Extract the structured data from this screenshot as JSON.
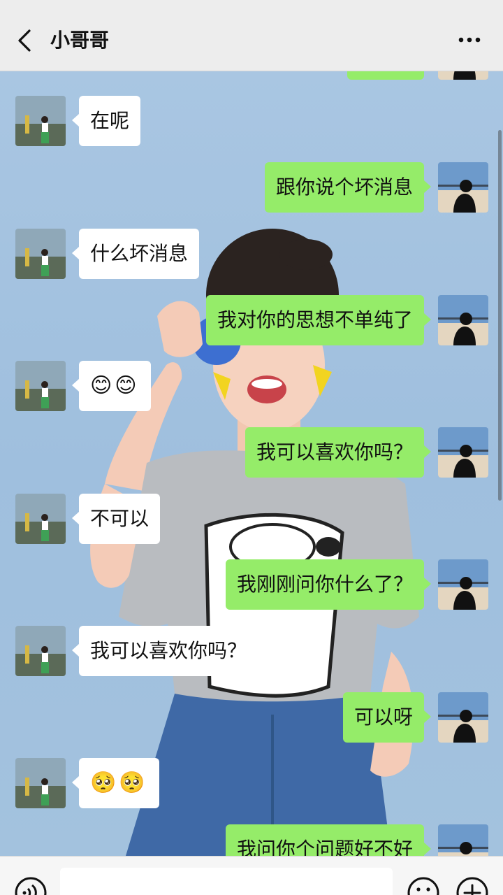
{
  "header": {
    "title": "小哥哥"
  },
  "messages": [
    {
      "side": "sent",
      "text": ""
    },
    {
      "side": "recv",
      "text": "在呢"
    },
    {
      "side": "sent",
      "text": "跟你说个坏消息"
    },
    {
      "side": "recv",
      "text": "什么坏消息"
    },
    {
      "side": "sent",
      "text": "我对你的思想不单纯了"
    },
    {
      "side": "recv",
      "text": "😊😊"
    },
    {
      "side": "sent",
      "text": "我可以喜欢你吗？"
    },
    {
      "side": "recv",
      "text": "不可以"
    },
    {
      "side": "sent",
      "text": "我刚刚问你什么了？"
    },
    {
      "side": "recv",
      "text": "我可以喜欢你吗？"
    },
    {
      "side": "sent",
      "text": "可以呀"
    },
    {
      "side": "recv",
      "text": "🥺🥺"
    },
    {
      "side": "sent",
      "text": "我问你个问题好不好"
    }
  ],
  "icons": {
    "back": "chevron-left-icon",
    "more": "more-dots-icon",
    "voice": "voice-icon",
    "emoji": "emoji-icon",
    "plus": "plus-icon"
  },
  "colors": {
    "sent_bubble": "#95ec69",
    "recv_bubble": "#ffffff",
    "nav_bg": "#ededed"
  }
}
